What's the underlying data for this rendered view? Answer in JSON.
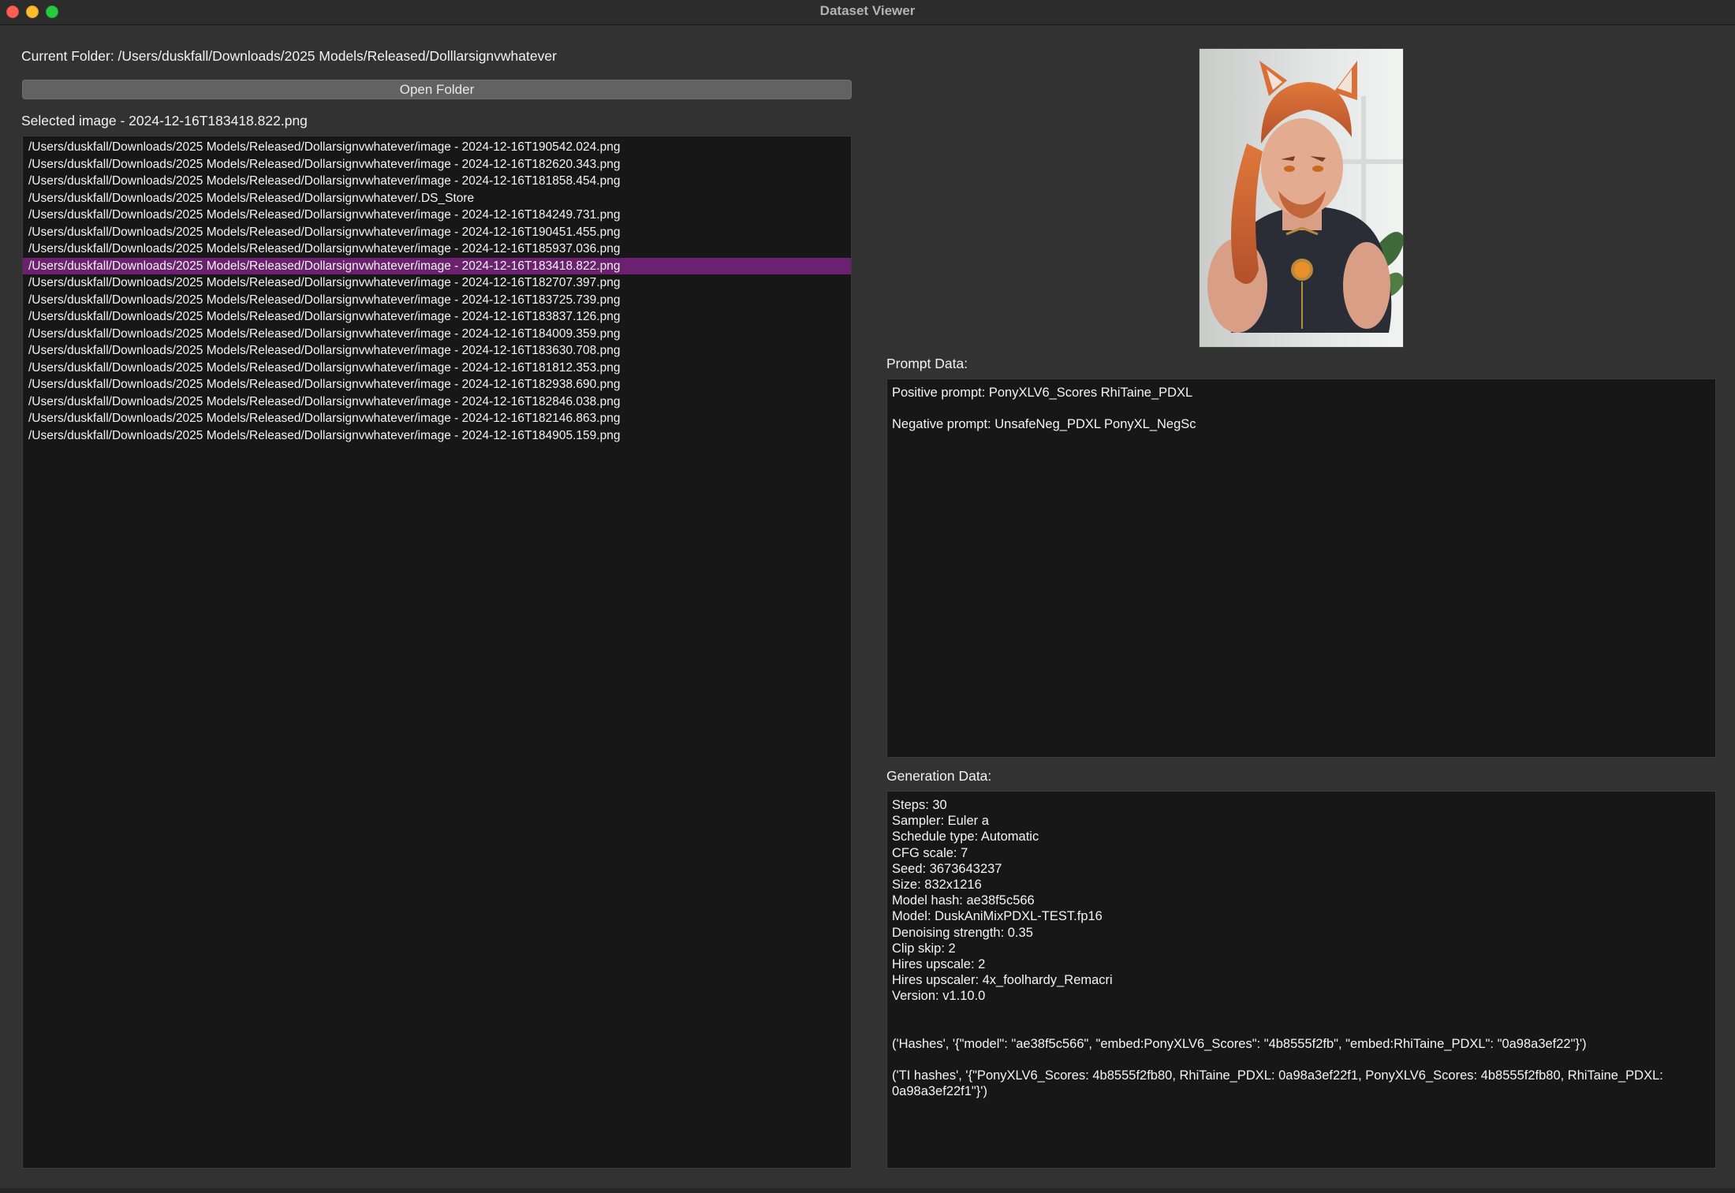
{
  "window": {
    "title": "Dataset Viewer"
  },
  "folder": {
    "label": "Current Folder: /Users/duskfall/Downloads/2025 Models/Released/Dolllarsignvwhatever",
    "open_button": "Open Folder"
  },
  "selection": {
    "label": "Selected image - 2024-12-16T183418.822.png"
  },
  "files": [
    "/Users/duskfall/Downloads/2025 Models/Released/Dollarsignvwhatever/image - 2024-12-16T190542.024.png",
    "/Users/duskfall/Downloads/2025 Models/Released/Dollarsignvwhatever/image - 2024-12-16T182620.343.png",
    "/Users/duskfall/Downloads/2025 Models/Released/Dollarsignvwhatever/image - 2024-12-16T181858.454.png",
    "/Users/duskfall/Downloads/2025 Models/Released/Dollarsignvwhatever/.DS_Store",
    "/Users/duskfall/Downloads/2025 Models/Released/Dollarsignvwhatever/image - 2024-12-16T184249.731.png",
    "/Users/duskfall/Downloads/2025 Models/Released/Dollarsignvwhatever/image - 2024-12-16T190451.455.png",
    "/Users/duskfall/Downloads/2025 Models/Released/Dollarsignvwhatever/image - 2024-12-16T185937.036.png",
    "/Users/duskfall/Downloads/2025 Models/Released/Dollarsignvwhatever/image - 2024-12-16T183418.822.png",
    "/Users/duskfall/Downloads/2025 Models/Released/Dollarsignvwhatever/image - 2024-12-16T182707.397.png",
    "/Users/duskfall/Downloads/2025 Models/Released/Dollarsignvwhatever/image - 2024-12-16T183725.739.png",
    "/Users/duskfall/Downloads/2025 Models/Released/Dollarsignvwhatever/image - 2024-12-16T183837.126.png",
    "/Users/duskfall/Downloads/2025 Models/Released/Dollarsignvwhatever/image - 2024-12-16T184009.359.png",
    "/Users/duskfall/Downloads/2025 Models/Released/Dollarsignvwhatever/image - 2024-12-16T183630.708.png",
    "/Users/duskfall/Downloads/2025 Models/Released/Dollarsignvwhatever/image - 2024-12-16T181812.353.png",
    "/Users/duskfall/Downloads/2025 Models/Released/Dollarsignvwhatever/image - 2024-12-16T182938.690.png",
    "/Users/duskfall/Downloads/2025 Models/Released/Dollarsignvwhatever/image - 2024-12-16T182846.038.png",
    "/Users/duskfall/Downloads/2025 Models/Released/Dollarsignvwhatever/image - 2024-12-16T182146.863.png",
    "/Users/duskfall/Downloads/2025 Models/Released/Dollarsignvwhatever/image - 2024-12-16T184905.159.png"
  ],
  "selected_index": 7,
  "prompt": {
    "label": "Prompt Data:",
    "positive": "Positive prompt: PonyXLV6_Scores  RhiTaine_PDXL",
    "negative": "Negative prompt: UnsafeNeg_PDXL PonyXL_NegSc"
  },
  "generation": {
    "label": "Generation Data:",
    "lines": [
      "Steps: 30",
      "Sampler: Euler a",
      "Schedule type: Automatic",
      "CFG scale: 7",
      "Seed: 3673643237",
      "Size: 832x1216",
      "Model hash: ae38f5c566",
      "Model: DuskAniMixPDXL-TEST.fp16",
      "Denoising strength: 0.35",
      "Clip skip: 2",
      "Hires upscale: 2",
      "Hires upscaler: 4x_foolhardy_Remacri",
      "Version: v1.10.0"
    ],
    "hashes": "('Hashes', '{\"model\": \"ae38f5c566\", \"embed:PonyXLV6_Scores\": \"4b8555f2fb\", \"embed:RhiTaine_PDXL\": \"0a98a3ef22\"}')",
    "ti_hashes": "('TI hashes', '{\"PonyXLV6_Scores: 4b8555f2fb80, RhiTaine_PDXL: 0a98a3ef22f1, PonyXLV6_Scores: 4b8555f2fb80, RhiTaine_PDXL: 0a98a3ef22f1\"}')"
  },
  "colors": {
    "selection_highlight": "#6b2070",
    "panel_background": "#171717",
    "window_background": "#323232"
  }
}
